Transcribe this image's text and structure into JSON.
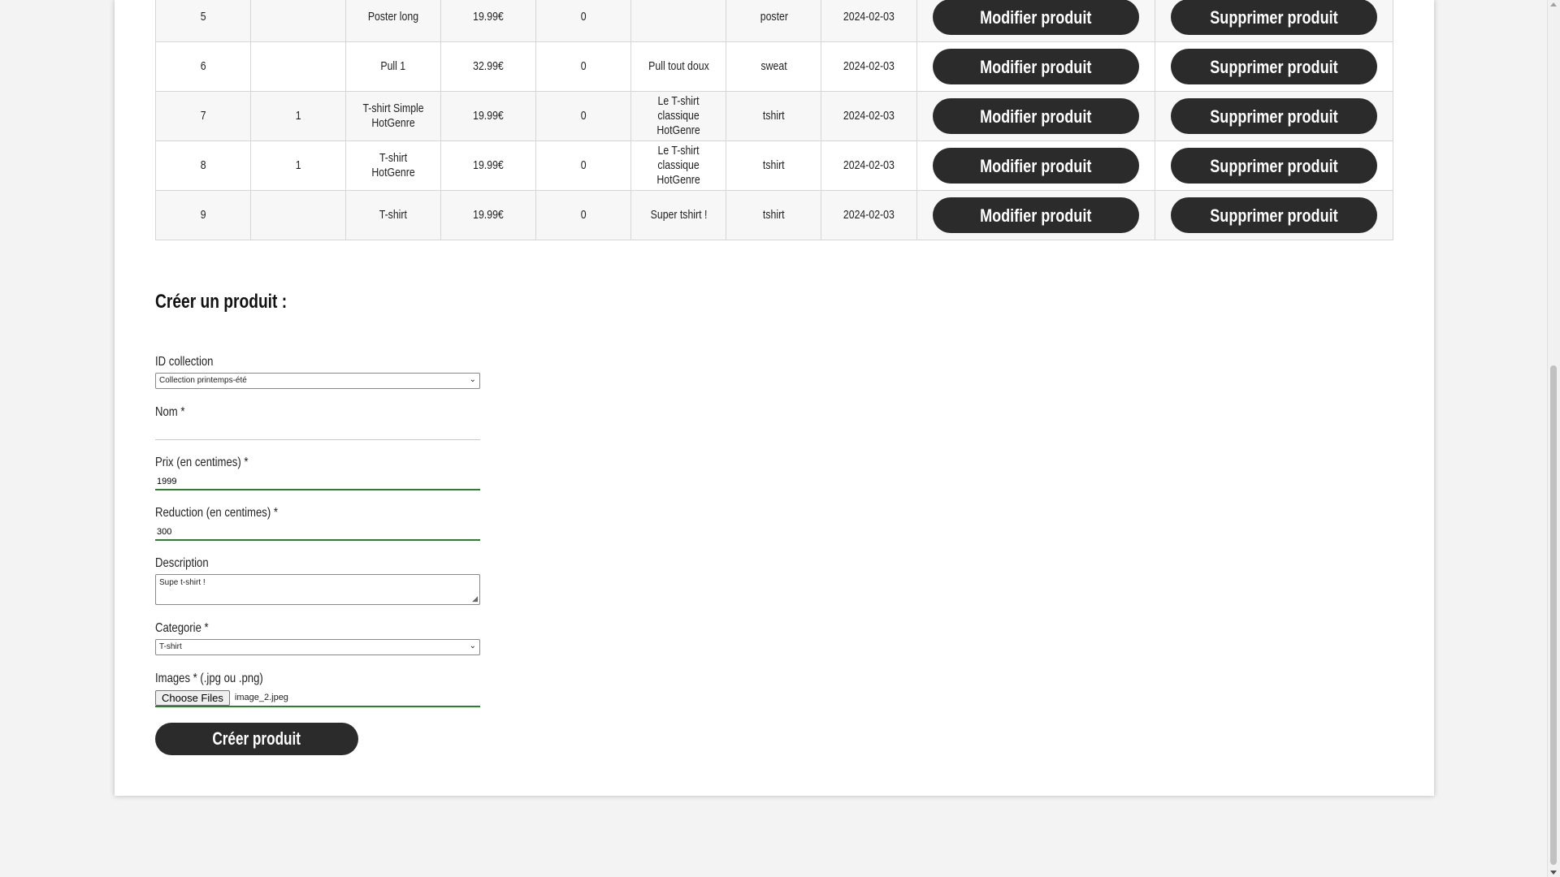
{
  "table": {
    "rows": [
      {
        "id": "5",
        "collection": "",
        "name": "Poster long",
        "price": "19.99€",
        "reduction": "0",
        "description": "",
        "category": "poster",
        "date": "2024-02-03"
      },
      {
        "id": "6",
        "collection": "",
        "name": "Pull 1",
        "price": "32.99€",
        "reduction": "0",
        "description": "Pull tout doux",
        "category": "sweat",
        "date": "2024-02-03"
      },
      {
        "id": "7",
        "collection": "1",
        "name": "T-shirt Simple HotGenre",
        "price": "19.99€",
        "reduction": "0",
        "description": "Le T-shirt classique HotGenre",
        "category": "tshirt",
        "date": "2024-02-03"
      },
      {
        "id": "8",
        "collection": "1",
        "name": "T-shirt HotGenre",
        "price": "19.99€",
        "reduction": "0",
        "description": "Le T-shirt classique HotGenre",
        "category": "tshirt",
        "date": "2024-02-03"
      },
      {
        "id": "9",
        "collection": "",
        "name": "T-shirt",
        "price": "19.99€",
        "reduction": "0",
        "description": "Super tshirt !",
        "category": "tshirt",
        "date": "2024-02-03"
      }
    ],
    "edit_label": "Modifier produit",
    "delete_label": "Supprimer produit"
  },
  "form": {
    "title": "Créer un produit :",
    "collection": {
      "label": "ID collection",
      "value": "Collection printemps-été"
    },
    "name": {
      "label": "Nom *",
      "value": ""
    },
    "price": {
      "label": "Prix (en centimes) *",
      "value": "1999"
    },
    "reduction": {
      "label": "Reduction (en centimes) *",
      "value": "300"
    },
    "description": {
      "label": "Description",
      "value": "Supe t-shirt !"
    },
    "category": {
      "label": "Categorie *",
      "value": "T-shirt"
    },
    "images": {
      "label": "Images * (.jpg ou .png)",
      "button": "Choose Files",
      "file": "image_2.jpeg"
    },
    "submit": "Créer produit"
  },
  "colors": {
    "button_bg": "#2b2b2b",
    "valid_underline": "#2f7d2f",
    "page_bg": "#f3f3f3"
  }
}
